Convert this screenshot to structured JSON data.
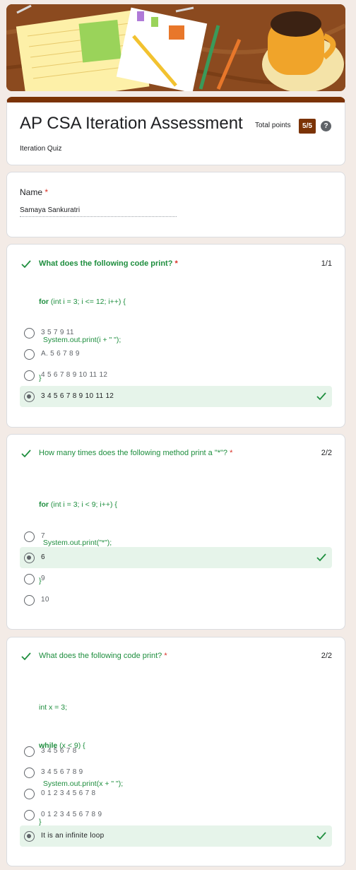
{
  "form": {
    "title": "AP CSA Iteration Assessment",
    "description": "Iteration Quiz",
    "total_label": "Total points",
    "total_score": "5/5",
    "help_icon": "?"
  },
  "name_field": {
    "label": "Name",
    "required_mark": "*",
    "value": "Samaya Sankuratri"
  },
  "questions": [
    {
      "title": "What does the following code print?",
      "required_mark": "*",
      "score": "1/1",
      "code": [
        {
          "kw": "for",
          "rest": " (int i = 3; i <= 12; i++) {"
        },
        {
          "kw": "",
          "rest": "  System.out.print(i + \" \");"
        },
        {
          "kw": "",
          "rest": "}"
        }
      ],
      "options": [
        {
          "label": "3 5 7 9 11",
          "selected": false
        },
        {
          "label": "A. 5 6 7 8 9",
          "selected": false
        },
        {
          "label": "4 5 6 7 8 9 10 11 12",
          "selected": false
        },
        {
          "label": "3 4 5 6 7 8 9 10 11 12",
          "selected": true
        }
      ]
    },
    {
      "title": "How many times does the following method print a \"*\"?",
      "required_mark": "*",
      "score": "2/2",
      "code": [
        {
          "kw": "for",
          "rest": " (int i = 3; i < 9; i++) {"
        },
        {
          "kw": "",
          "rest": "  System.out.print(\"*\");"
        },
        {
          "kw": "",
          "rest": "}"
        }
      ],
      "options": [
        {
          "label": "7",
          "selected": false
        },
        {
          "label": "6",
          "selected": true
        },
        {
          "label": "9",
          "selected": false
        },
        {
          "label": "10",
          "selected": false
        }
      ]
    },
    {
      "title": "What does the following code print?",
      "required_mark": "*",
      "score": "2/2",
      "code": [
        {
          "kw": "",
          "rest": "int x = 3;"
        },
        {
          "kw": "while",
          "rest": " (x < 9) {"
        },
        {
          "kw": "",
          "rest": "  System.out.print(x + \" \");"
        },
        {
          "kw": "",
          "rest": "}"
        }
      ],
      "options": [
        {
          "label": "3 4 5 6 7 8",
          "selected": false
        },
        {
          "label": "3 4 5 6 7 8 9",
          "selected": false
        },
        {
          "label": "0 1 2 3 4 5 6 7 8",
          "selected": false
        },
        {
          "label": "0 1 2 3 4 5 6 7 8 9",
          "selected": false
        },
        {
          "label": "It is an infinite loop",
          "selected": true
        }
      ]
    }
  ],
  "colors": {
    "accent": "#7b3306",
    "correct": "#1e8e3e",
    "selected_bg": "#e6f4ea",
    "page_bg": "#f3ebe6"
  }
}
